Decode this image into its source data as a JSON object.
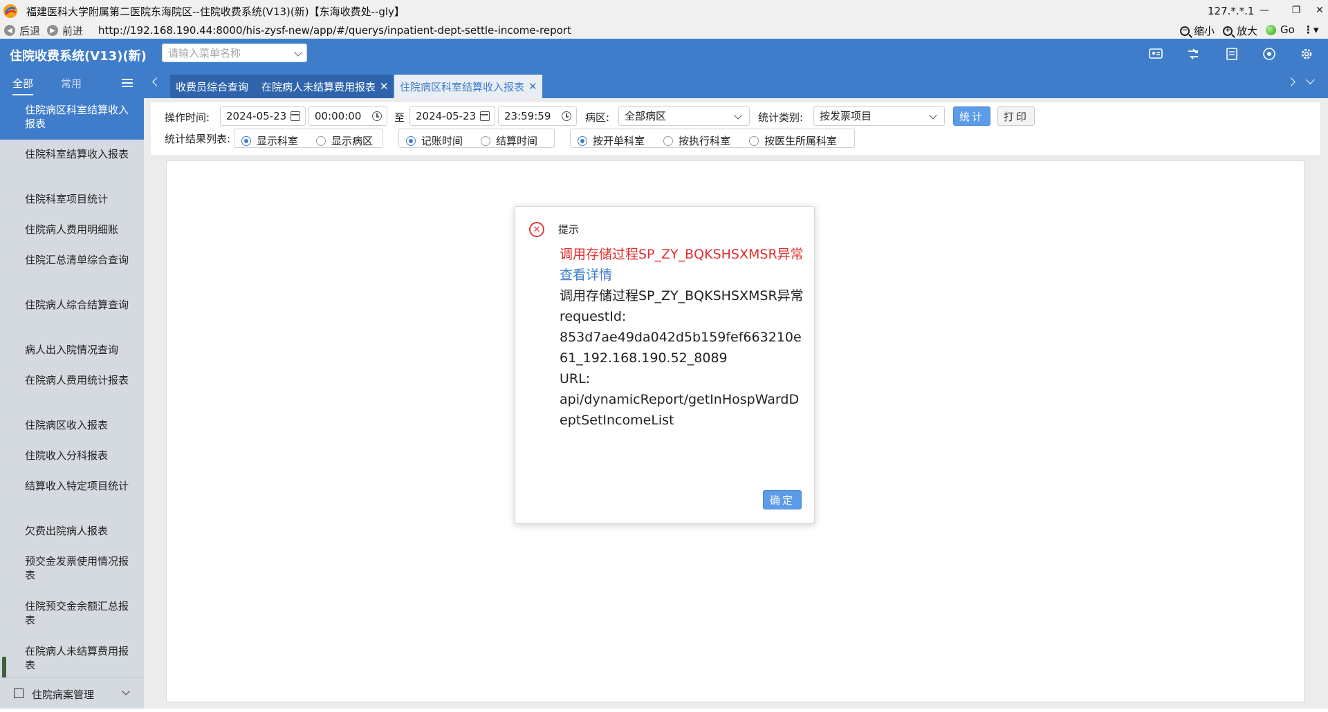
{
  "window": {
    "title": "福建医科大学附属第二医院东海院区--住院收费系统(V13)(新)【东海收费处--gly】",
    "ip": "127.*.*.1"
  },
  "browser": {
    "back_label": "后退",
    "forward_label": "前进",
    "url": "http://192.168.190.44:8000/his-zysf-new/app/#/querys/inpatient-dept-settle-income-report",
    "zoom_out_label": "缩小",
    "zoom_in_label": "放大",
    "go_label": "Go"
  },
  "header": {
    "app_title": "住院收费系统(V13)(新)",
    "menu_search_placeholder": "请输入菜单名称",
    "accent_color": "#3f7dcb"
  },
  "sidebar": {
    "tabs": [
      "全部",
      "常用"
    ],
    "items": [
      "住院病区科室结算收入报表",
      "住院科室结算收入报表",
      "住院科室项目统计",
      "住院病人费用明细账",
      "住院汇总清单综合查询",
      "住院病人综合结算查询",
      "病人出入院情况查询",
      "在院病人费用统计报表",
      "住院病区收入报表",
      "住院收入分科报表",
      "结算收入特定项目统计",
      "欠费出院病人报表",
      "预交金发票使用情况报表",
      "住院预交金余额汇总报表",
      "在院病人未结算费用报表"
    ],
    "footer_label": "住院病案管理"
  },
  "tabs": [
    {
      "label": "收费员综合查询",
      "closable": false,
      "active": false
    },
    {
      "label": "在院病人未结算费用报表",
      "closable": true,
      "active": false
    },
    {
      "label": "住院病区科室结算收入报表",
      "closable": true,
      "active": true
    }
  ],
  "filters": {
    "op_time_label": "操作时间:",
    "start_date": "2024-05-23",
    "start_time": "00:00:00",
    "to_label": "至",
    "end_date": "2024-05-23",
    "end_time": "23:59:59",
    "ward_label": "病区:",
    "ward_value": "全部病区",
    "stat_type_label": "统计类别:",
    "stat_type_value": "按发票项目",
    "stat_button": "统计",
    "print_button": "打印",
    "result_list_label": "统计结果列表:",
    "radio_group1": [
      {
        "label": "显示科室",
        "checked": true
      },
      {
        "label": "显示病区",
        "checked": false
      }
    ],
    "radio_group2": [
      {
        "label": "记账时间",
        "checked": true
      },
      {
        "label": "结算时间",
        "checked": false
      }
    ],
    "radio_group3": [
      {
        "label": "按开单科室",
        "checked": true
      },
      {
        "label": "按执行科室",
        "checked": false
      },
      {
        "label": "按医生所属科室",
        "checked": false
      }
    ]
  },
  "dialog": {
    "title": "提示",
    "error_message": "调用存储过程SP_ZY_BQKSHSXMSR异常",
    "details_link": "查看详情",
    "detail_message": "调用存储过程SP_ZY_BQKSHSXMSR异常",
    "request_label": "requestId:",
    "request_id": "853d7ae49da042d5b159fef663210e61_192.168.190.52_8089",
    "url_label": "URL:",
    "url_value": "api/dynamicReport/getInHospWardDeptSetIncomeList",
    "ok_button": "确定",
    "error_color": "#e02c2c"
  }
}
